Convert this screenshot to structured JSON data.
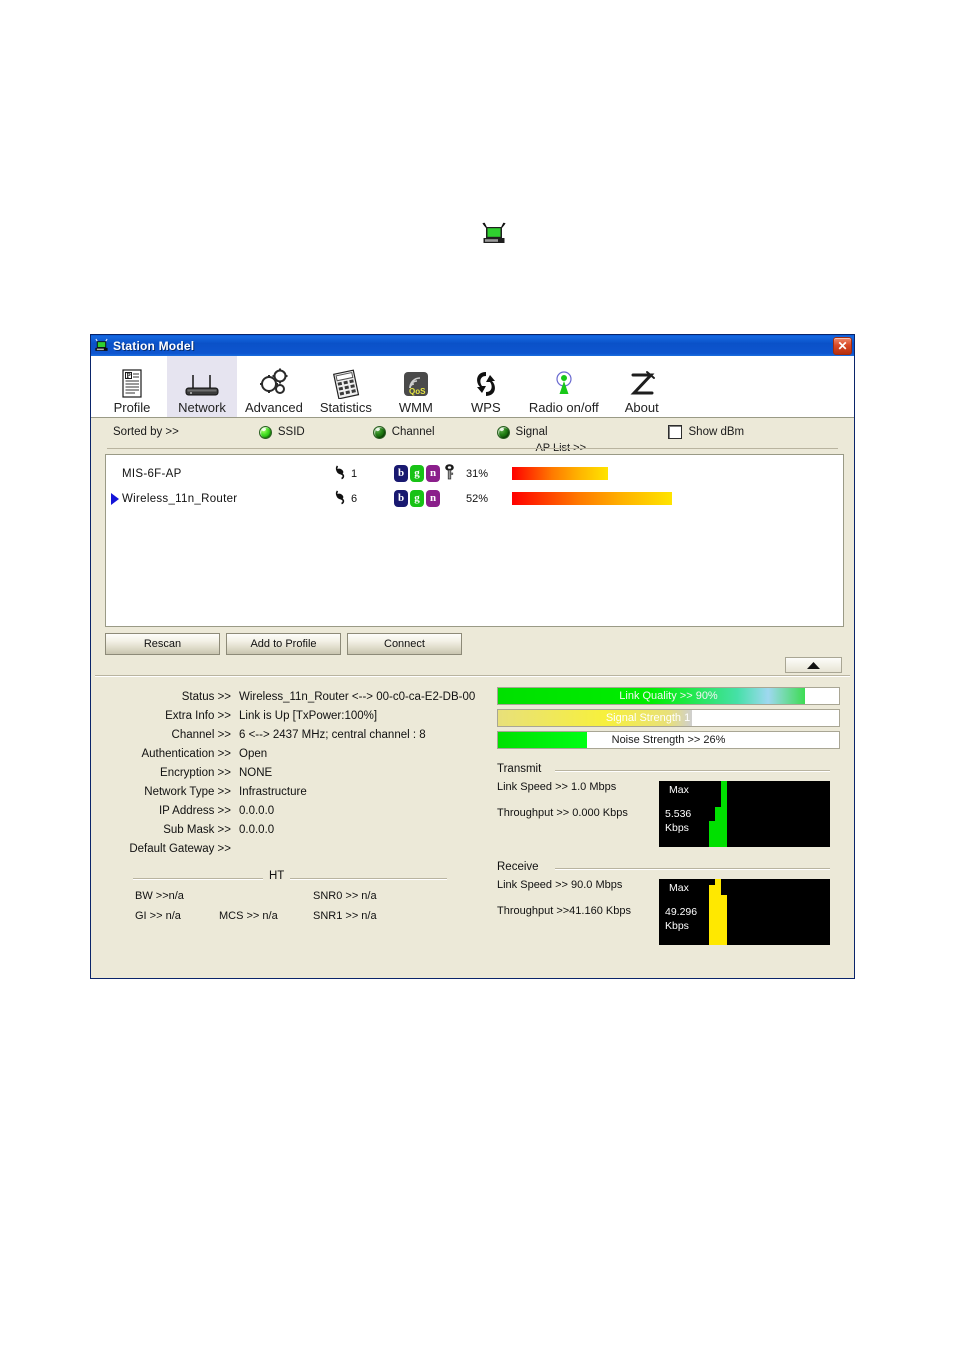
{
  "standalone_icon": "wireless-station-icon",
  "window": {
    "title": "Station Model",
    "title_icon": "wireless-station-icon",
    "close_label": "✕"
  },
  "toolbar": {
    "tabs": [
      {
        "label": "Profile",
        "icon": "profile-document-icon",
        "active": false
      },
      {
        "label": "Network",
        "icon": "router-icon",
        "active": true
      },
      {
        "label": "Advanced",
        "icon": "gears-icon",
        "active": false
      },
      {
        "label": "Statistics",
        "icon": "calculator-icon",
        "active": false
      },
      {
        "label": "WMM",
        "icon": "qos-icon",
        "active": false
      },
      {
        "label": "WPS",
        "icon": "wps-arrows-icon",
        "active": false
      },
      {
        "label": "Radio on/off",
        "icon": "radio-antenna-icon",
        "active": false
      },
      {
        "label": "About",
        "icon": "about-z-icon",
        "active": false
      }
    ]
  },
  "sortbar": {
    "label": "Sorted by >>",
    "options": [
      {
        "label": "SSID",
        "selected": true
      },
      {
        "label": "Channel",
        "selected": false
      },
      {
        "label": "Signal",
        "selected": false
      }
    ],
    "show_dbm": {
      "label": "Show dBm",
      "checked": false
    },
    "ap_list_label": "AP List >>"
  },
  "ap_list": {
    "rows": [
      {
        "selected": false,
        "ssid": "MIS-6F-AP",
        "channel": "1",
        "channel_icon": "channel-antenna-icon",
        "badges": [
          "b",
          "g",
          "n"
        ],
        "secured": true,
        "security_icon": "key-icon",
        "signal_pct": "31%",
        "signal_value": 31
      },
      {
        "selected": true,
        "selected_icon": "play-arrow-icon",
        "ssid": "Wireless_11n_Router",
        "channel": "6",
        "channel_icon": "channel-antenna-icon",
        "badges": [
          "b",
          "g",
          "n"
        ],
        "secured": false,
        "signal_pct": "52%",
        "signal_value": 52
      }
    ]
  },
  "buttons": {
    "rescan": "Rescan",
    "add_to_profile": "Add to Profile",
    "connect": "Connect",
    "collapse_icon": "triangle-up-icon"
  },
  "details": {
    "rows": [
      {
        "key": "Status >>",
        "value": "Wireless_11n_Router <--> 00-c0-ca-E2-DB-00"
      },
      {
        "key": "Extra Info >>",
        "value": "Link is Up [TxPower:100%]"
      },
      {
        "key": "Channel >>",
        "value": "6 <--> 2437 MHz; central channel : 8"
      },
      {
        "key": "Authentication >>",
        "value": "Open"
      },
      {
        "key": "Encryption >>",
        "value": "NONE"
      },
      {
        "key": "Network Type >>",
        "value": "Infrastructure"
      },
      {
        "key": "IP Address >>",
        "value": "0.0.0.0"
      },
      {
        "key": "Sub Mask >>",
        "value": "0.0.0.0"
      },
      {
        "key": "Default Gateway >>",
        "value": ""
      }
    ],
    "ht": {
      "title": "HT",
      "bw": "BW >>n/a",
      "gi": "GI >> n/a",
      "mcs": "MCS >>  n/a",
      "snr0": "SNR0 >>  n/a",
      "snr1": "SNR1 >>  n/a"
    },
    "meters": [
      {
        "label": "Link Quality >> 90%",
        "value": 90,
        "name": "link-quality-meter"
      },
      {
        "label": "Signal Strength 1 >> 57%",
        "value": 57,
        "name": "signal-strength-meter"
      },
      {
        "label": "Noise Strength >> 26%",
        "value": 26,
        "name": "noise-strength-meter"
      }
    ],
    "transmit": {
      "title": "Transmit",
      "link_speed": "Link Speed >>  1.0 Mbps",
      "throughput": "Throughput >> 0.000 Kbps",
      "graph_max": "Max",
      "graph_value": "5.536",
      "graph_unit": "Kbps",
      "bar_color": "#00e000"
    },
    "receive": {
      "title": "Receive",
      "link_speed": "Link Speed >> 90.0 Mbps",
      "throughput": "Throughput >>41.160 Kbps",
      "graph_max": "Max",
      "graph_value": "49.296",
      "graph_unit": "Kbps",
      "bar_color": "#ffe800"
    }
  }
}
